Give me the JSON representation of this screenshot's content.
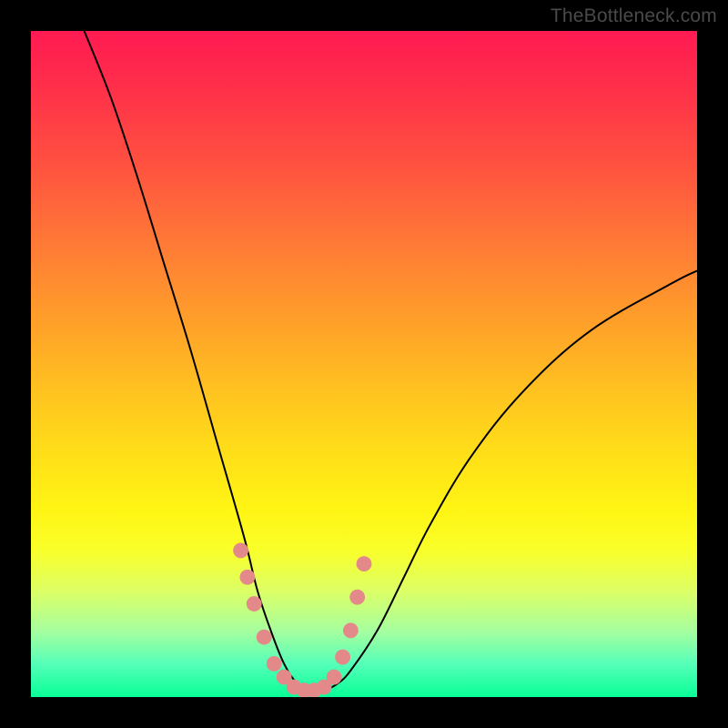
{
  "watermark": "TheBottleneck.com",
  "chart_data": {
    "type": "line",
    "title": "",
    "xlabel": "",
    "ylabel": "",
    "xlim": [
      0,
      100
    ],
    "ylim": [
      0,
      100
    ],
    "background": {
      "style": "vertical-gradient",
      "stops": [
        {
          "pos": 0,
          "color": "#ff1a52"
        },
        {
          "pos": 50,
          "color": "#ffc220"
        },
        {
          "pos": 80,
          "color": "#f9ff2a"
        },
        {
          "pos": 100,
          "color": "#08ff97"
        }
      ]
    },
    "series": [
      {
        "name": "bottleneck-curve",
        "description": "V-shaped bottleneck curve; y is bottleneck severity (100=high/red, 0=none/green)",
        "x": [
          8,
          12,
          16,
          20,
          24,
          28,
          32,
          34,
          36,
          38,
          40,
          42,
          44,
          46,
          48,
          52,
          56,
          60,
          66,
          74,
          84,
          96,
          100
        ],
        "y": [
          100,
          90,
          78,
          65,
          52,
          38,
          24,
          16,
          10,
          5,
          2,
          1,
          1,
          2,
          4,
          10,
          18,
          26,
          36,
          46,
          55,
          62,
          64
        ]
      }
    ],
    "markers": {
      "name": "highlight-dots",
      "color": "#e38989",
      "x": [
        31.5,
        32.5,
        33.5,
        35,
        36.5,
        38,
        39.5,
        41,
        42.5,
        44,
        45.5,
        46.8,
        48,
        49,
        50
      ],
      "y": [
        22,
        18,
        14,
        9,
        5,
        3,
        1.5,
        1,
        1,
        1.5,
        3,
        6,
        10,
        15,
        20
      ]
    }
  }
}
